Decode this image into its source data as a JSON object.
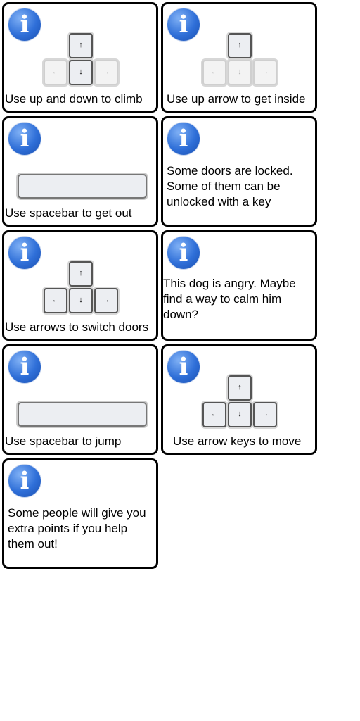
{
  "icons": {
    "info": "i"
  },
  "arrows": {
    "up": "↑",
    "down": "↓",
    "left": "←",
    "right": "→"
  },
  "cards": [
    {
      "text": "Use up and down to climb",
      "keys": "up-down"
    },
    {
      "text": "Use up arrow to get inside",
      "keys": "up"
    },
    {
      "text": "Use spacebar to get out",
      "keys": "spacebar"
    },
    {
      "text": "Some doors are locked. Some of them can be unlocked with a key"
    },
    {
      "text": "Use arrows to switch doors",
      "keys": "all"
    },
    {
      "text": "This dog is angry. Maybe find a way to calm him down?"
    },
    {
      "text": "Use spacebar to jump",
      "keys": "spacebar"
    },
    {
      "text": "Use arrow keys to move",
      "keys": "all"
    },
    {
      "text": "Some people will give you extra points if you help them out!"
    }
  ],
  "colors": {
    "icon": "#2f6fd8",
    "border": "#000000"
  }
}
